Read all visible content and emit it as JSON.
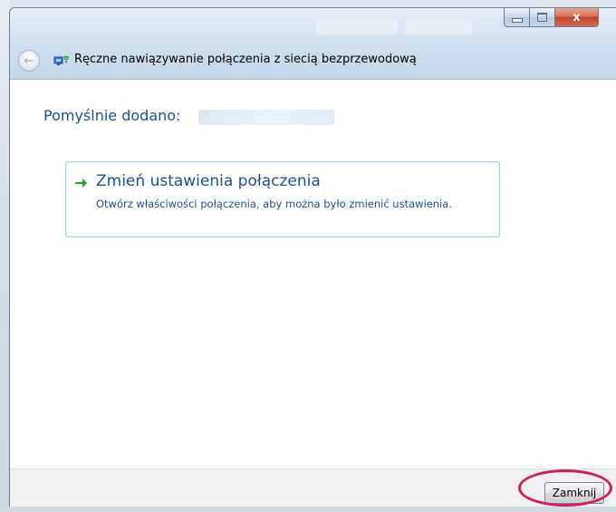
{
  "window": {
    "title": "Ręczne nawiązywanie połączenia z siecią bezprzewodową",
    "close_glyph": "x"
  },
  "icons": {
    "back": "back-arrow-icon",
    "network": "wireless-network-icon",
    "option_arrow": "green-arrow-icon",
    "close": "close-icon"
  },
  "content": {
    "heading": "Pomyślnie dodano:"
  },
  "option": {
    "title": "Zmień ustawienia połączenia",
    "description": "Otwórz właściwości połączenia, aby można było zmienić ustawienia."
  },
  "footer": {
    "close_button_label": "Zamknij"
  },
  "colors": {
    "heading_blue": "#1e4d9a",
    "highlight_ring": "#d11e5d",
    "arrow_green": "#1fa33a"
  }
}
